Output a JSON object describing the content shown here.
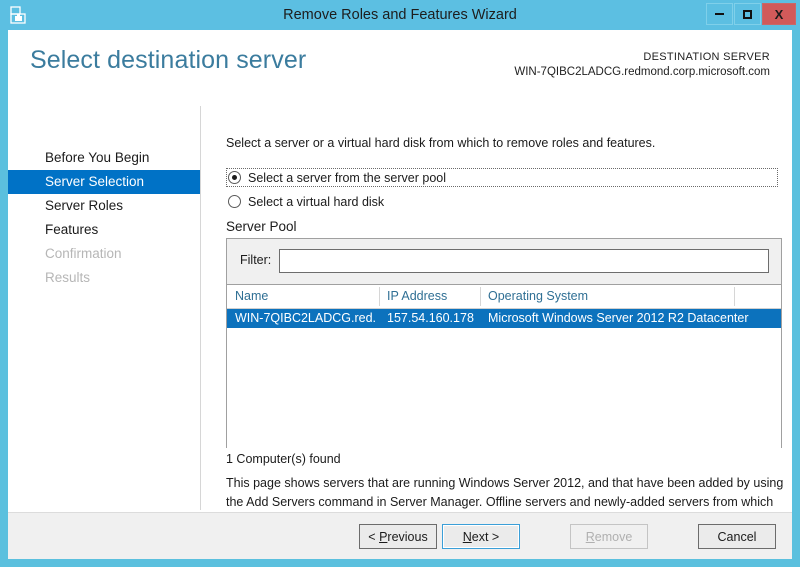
{
  "window": {
    "title": "Remove Roles and Features Wizard",
    "icon": "server-wizard-icon",
    "controls": {
      "minimize": "minimize-icon",
      "maximize": "maximize-icon",
      "close": "X"
    }
  },
  "header": {
    "page_title": "Select destination server",
    "destination_label": "DESTINATION SERVER",
    "destination_server": "WIN-7QIBC2LADCG.redmond.corp.microsoft.com"
  },
  "sidebar": {
    "items": [
      {
        "label": "Before You Begin",
        "state": "normal"
      },
      {
        "label": "Server Selection",
        "state": "selected"
      },
      {
        "label": "Server Roles",
        "state": "normal"
      },
      {
        "label": "Features",
        "state": "normal"
      },
      {
        "label": "Confirmation",
        "state": "disabled"
      },
      {
        "label": "Results",
        "state": "disabled"
      }
    ]
  },
  "content": {
    "intro": "Select a server or a virtual hard disk from which to remove roles and features.",
    "options": [
      {
        "label": "Select a server from the server pool",
        "selected": true,
        "focused": true
      },
      {
        "label": "Select a virtual hard disk",
        "selected": false,
        "focused": false
      }
    ],
    "pool_heading": "Server Pool",
    "filter": {
      "label": "Filter:",
      "value": "",
      "placeholder": ""
    },
    "grid": {
      "columns": [
        "Name",
        "IP Address",
        "Operating System",
        ""
      ],
      "rows": [
        {
          "selected": true,
          "cells": [
            "WIN-7QIBC2LADCG.red...",
            "157.54.160.178",
            "Microsoft Windows Server 2012 R2 Datacenter",
            ""
          ]
        }
      ]
    },
    "found_text": "1 Computer(s) found",
    "note": "This page shows servers that are running Windows Server 2012, and that have been added by using the Add Servers command in Server Manager. Offline servers and newly-added servers from which data collection is still incomplete are not shown."
  },
  "footer": {
    "previous": "< Previous",
    "next_prefix": "",
    "next_accel": "N",
    "next_suffix": "ext >",
    "previous_prefix": "< ",
    "previous_accel": "P",
    "previous_suffix": "revious",
    "remove_accel": "R",
    "remove_suffix": "emove",
    "cancel": "Cancel"
  },
  "colors": {
    "window_border": "#5cbfe2",
    "accent_selected": "#0072c6",
    "row_selected": "#0c72bd",
    "title_text": "#3b7c9e",
    "column_header_text": "#2f6f94",
    "close_button": "#d15a5a"
  }
}
